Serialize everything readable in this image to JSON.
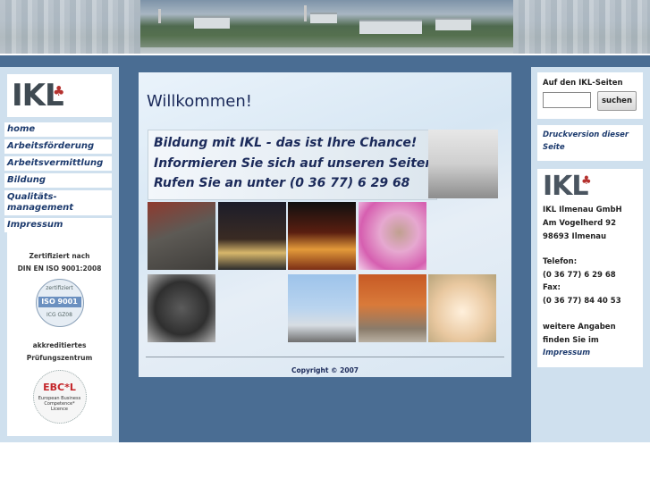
{
  "banner": {
    "description_alt": ""
  },
  "logo": {
    "text": "IKL",
    "mark": "♣"
  },
  "nav": {
    "items": [
      {
        "label": "home"
      },
      {
        "label": "Arbeitsförderung"
      },
      {
        "label": "Arbeitsvermittlung"
      },
      {
        "label": "Bildung"
      },
      {
        "label": "Qualitäts-"
      },
      {
        "label": "management"
      },
      {
        "label": "Impressum"
      }
    ]
  },
  "cert": {
    "line1": "Zertifiziert nach",
    "line2": "DIN EN ISO 9001:2008",
    "iso_badge_top": "zertifiziert",
    "iso_badge_main": "ISO 9001",
    "iso_badge_bottom": "ICG GZ08",
    "accr1": "akkreditiertes",
    "accr2": "Prüfungszentrum",
    "ebcl_title": "EBC*L",
    "ebcl_sub": "European Business Competence* Licence"
  },
  "main": {
    "title": "Willkommen!",
    "chance_lines": [
      "Bildung mit IKL - das ist Ihre Chance!",
      "Informieren Sie sich auf unseren Seiten ...",
      "Rufen Sie an unter (0 36 77) 6 29 68"
    ],
    "copyright": "Copyright © 2007"
  },
  "search": {
    "label": "Auf den IKL-Seiten",
    "placeholder": "",
    "button": "suchen"
  },
  "druck": {
    "line1": "Druckversion dieser",
    "line2": "Seite"
  },
  "address": {
    "logo_text": "IKL",
    "logo_mark": "♣",
    "company": "IKL Ilmenau GmbH",
    "street": "Am Vogelherd 92",
    "city": "98693 Ilmenau",
    "tel_label": "Telefon:",
    "tel": "(0 36 77) 6 29 68",
    "fax_label": "Fax:",
    "fax": "(0 36 77) 84 40 53",
    "more1": "weitere Angaben",
    "more2": "finden Sie im",
    "impressum_link": "Impressum"
  },
  "colors": {
    "page_blue": "#4a6d93",
    "side_panel": "#cfe0ee",
    "link_blue": "#1d3b6e",
    "heading": "#1b2a5a"
  }
}
